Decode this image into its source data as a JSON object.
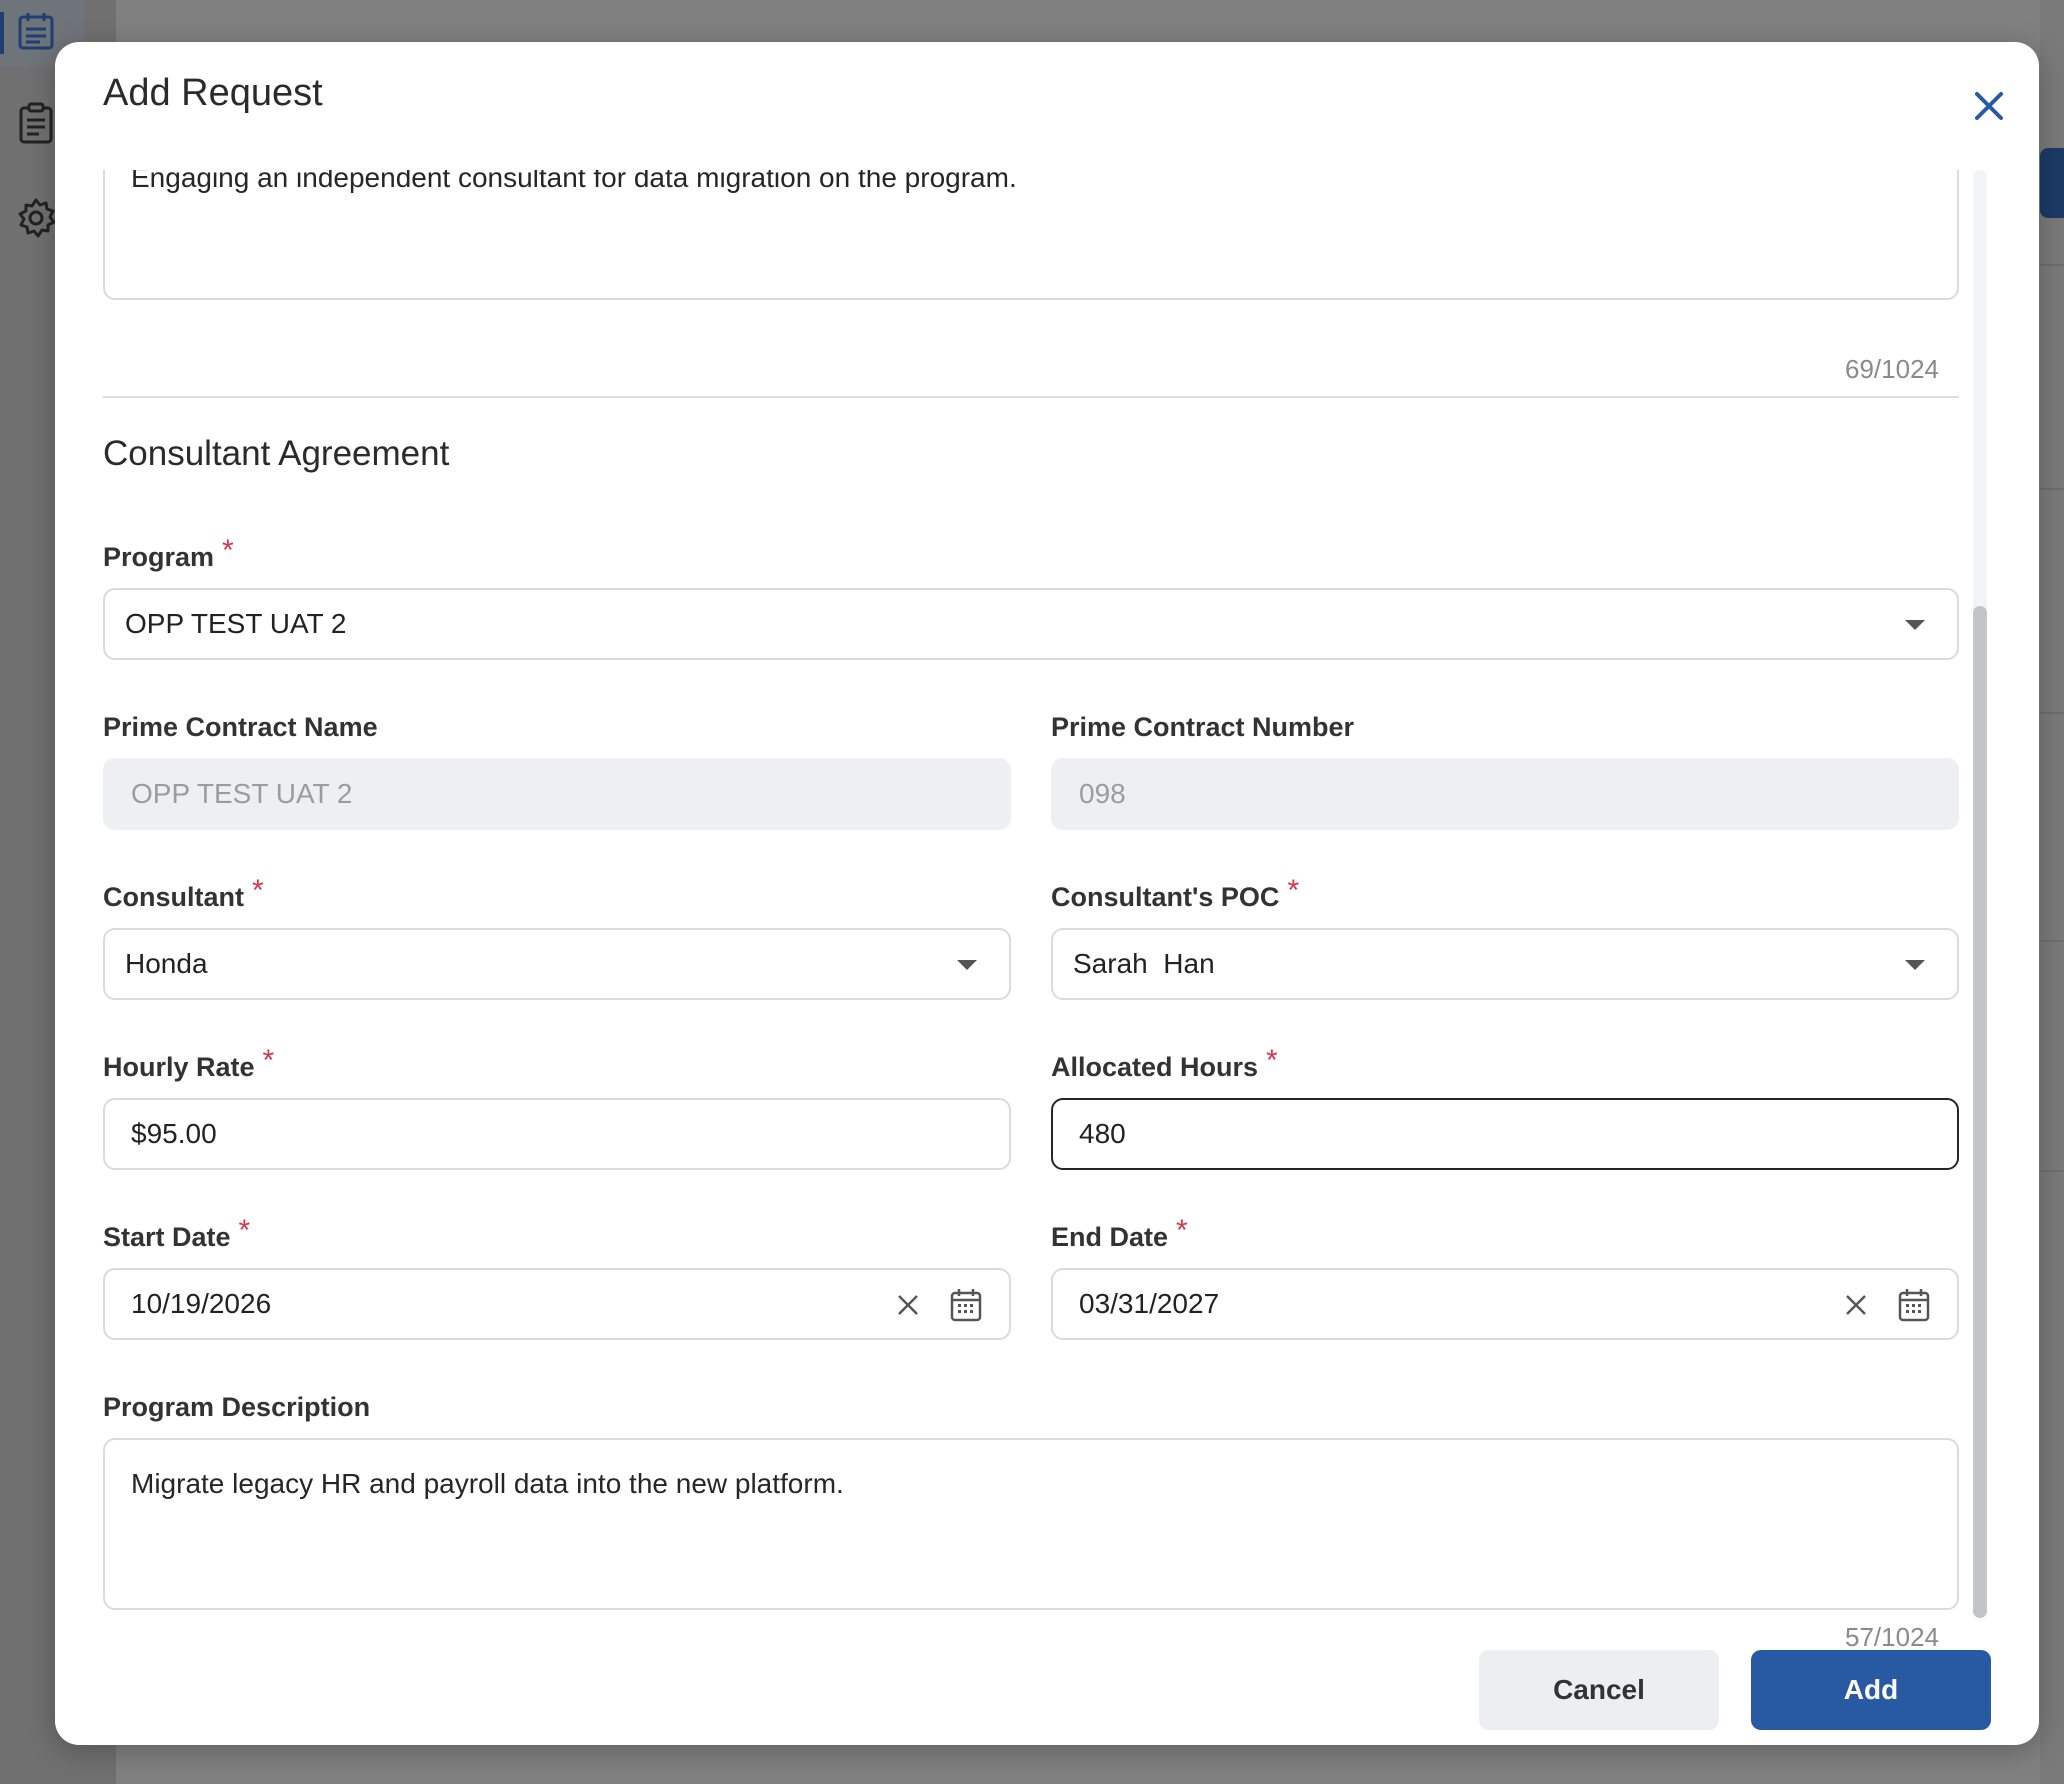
{
  "dialog": {
    "title": "Add Request",
    "close_icon": "close-icon"
  },
  "prior_textarea": {
    "value": "Engaging an independent consultant for data migration on the program.",
    "counter": "69/1024"
  },
  "section": {
    "title": "Consultant Agreement"
  },
  "fields": {
    "program": {
      "label": "Program",
      "value": "OPP TEST UAT 2",
      "required": "*"
    },
    "prime_contract_name": {
      "label": "Prime Contract Name",
      "value": "OPP TEST UAT 2"
    },
    "prime_contract_number": {
      "label": "Prime Contract Number",
      "value": "098"
    },
    "consultant": {
      "label": "Consultant",
      "value": "Honda",
      "required": "*"
    },
    "consultant_poc": {
      "label": "Consultant's POC",
      "value": "Sarah  Han",
      "required": "*"
    },
    "hourly_rate": {
      "label": "Hourly Rate",
      "value": "$95.00",
      "required": "*"
    },
    "allocated_hours": {
      "label": "Allocated Hours",
      "value": "480",
      "required": "*"
    },
    "start_date": {
      "label": "Start Date",
      "value": "10/19/2026",
      "required": "*"
    },
    "end_date": {
      "label": "End Date",
      "value": "03/31/2027",
      "required": "*"
    },
    "program_description": {
      "label": "Program Description",
      "value": "Migrate legacy HR and payroll data into the new platform.",
      "counter": "57/1024"
    }
  },
  "footer": {
    "cancel_label": "Cancel",
    "add_label": "Add"
  },
  "colors": {
    "accent": "#2859a3",
    "required": "#d6364d",
    "disabled_bg": "#eeeff1"
  },
  "background_sidebar": {
    "icons": [
      "calendar-icon",
      "clipboard-icon",
      "gear-icon"
    ]
  }
}
